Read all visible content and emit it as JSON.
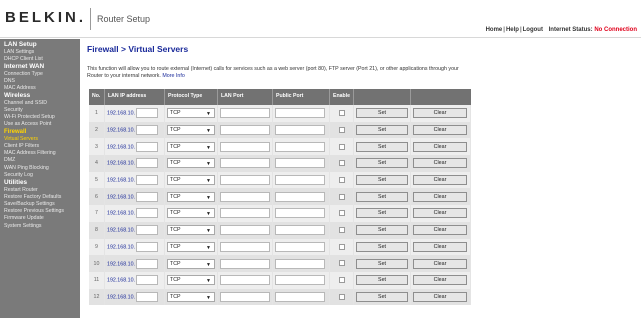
{
  "header": {
    "logo": "BELKIN.",
    "title": "Router Setup",
    "links": [
      "Home",
      "Help",
      "Logout"
    ],
    "status_label": "Internet Status:",
    "status_value": "No Connection",
    "status_color": "#e0001b"
  },
  "sidebar": [
    {
      "type": "section",
      "label": "LAN Setup"
    },
    {
      "type": "item",
      "label": "LAN Settings"
    },
    {
      "type": "item",
      "label": "DHCP Client List"
    },
    {
      "type": "section",
      "label": "Internet WAN"
    },
    {
      "type": "item",
      "label": "Connection Type"
    },
    {
      "type": "item",
      "label": "DNS"
    },
    {
      "type": "item",
      "label": "MAC Address"
    },
    {
      "type": "section",
      "label": "Wireless"
    },
    {
      "type": "item",
      "label": "Channel and SSID"
    },
    {
      "type": "item",
      "label": "Security"
    },
    {
      "type": "item",
      "label": "Wi-Fi Protected Setup"
    },
    {
      "type": "item",
      "label": "Use as Access Point"
    },
    {
      "type": "active",
      "label": "Firewall"
    },
    {
      "type": "current",
      "label": "Virtual Servers"
    },
    {
      "type": "item",
      "label": "Client IP Filters"
    },
    {
      "type": "item",
      "label": "MAC Address Filtering"
    },
    {
      "type": "item",
      "label": "DMZ"
    },
    {
      "type": "item",
      "label": "WAN Ping Blocking"
    },
    {
      "type": "item",
      "label": "Security Log"
    },
    {
      "type": "section",
      "label": "Utilities"
    },
    {
      "type": "item",
      "label": "Restart Router"
    },
    {
      "type": "item",
      "label": "Restore Factory Defaults"
    },
    {
      "type": "item",
      "label": "Save/Backup Settings"
    },
    {
      "type": "item",
      "label": "Restore Previous Settings"
    },
    {
      "type": "item",
      "label": "Firmware Update"
    },
    {
      "type": "item",
      "label": "System Settings"
    }
  ],
  "main": {
    "title": "Firewall > Virtual Servers",
    "description": "This function will allow you to route external (Internet) calls for services such as a web server (port 80), FTP server (Port 21), or other applications through your Router to your internal network.",
    "more_info": "More Info",
    "columns": [
      "No.",
      "LAN IP address",
      "Protocol Type",
      "LAN Port",
      "Public Port",
      "Enable"
    ],
    "ip_prefix": "192.168.10.",
    "protocol_default": "TCP",
    "dropdown_icon": "chevron-down-icon",
    "set_label": "Set",
    "clear_label": "Clear",
    "rows": [
      "1",
      "2",
      "3",
      "4",
      "5",
      "6",
      "7",
      "8",
      "9",
      "10",
      "11",
      "12"
    ]
  }
}
